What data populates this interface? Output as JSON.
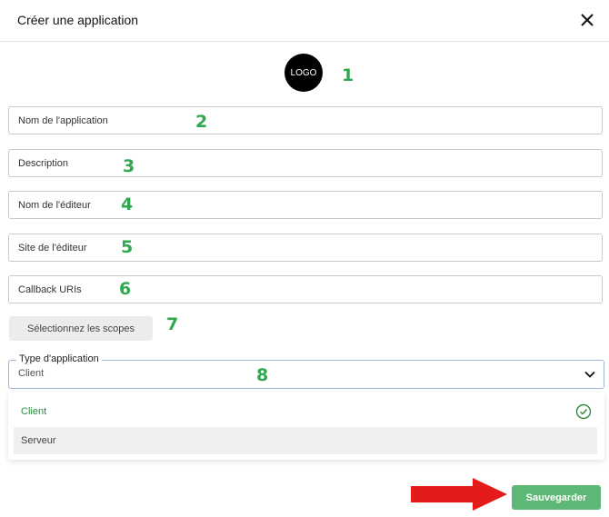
{
  "dialog": {
    "title": "Créer une application"
  },
  "logo": {
    "text": "LOGO"
  },
  "annotations": [
    "1",
    "2",
    "3",
    "4",
    "5",
    "6",
    "7",
    "8"
  ],
  "fields": {
    "app_name": {
      "placeholder": "Nom de l'application",
      "value": ""
    },
    "description": {
      "placeholder": "Description",
      "value": ""
    },
    "editor_name": {
      "placeholder": "Nom de l'éditeur",
      "value": ""
    },
    "editor_site": {
      "placeholder": "Site de l'éditeur",
      "value": ""
    },
    "callback_uris": {
      "placeholder": "Callback URIs",
      "value": ""
    }
  },
  "scopes_button": {
    "label": "Sélectionnez les scopes"
  },
  "app_type": {
    "label": "Type d'application",
    "selected": "Client",
    "options": [
      "Client",
      "Serveur"
    ]
  },
  "save_button": {
    "label": "Sauvegarder"
  },
  "colors": {
    "accent_green": "#5cb874",
    "annotation_green": "#2fa84f",
    "arrow_red": "#e31b1b"
  },
  "icons": [
    "close-icon",
    "chevron-down-icon",
    "check-circle-icon",
    "red-arrow-icon"
  ]
}
